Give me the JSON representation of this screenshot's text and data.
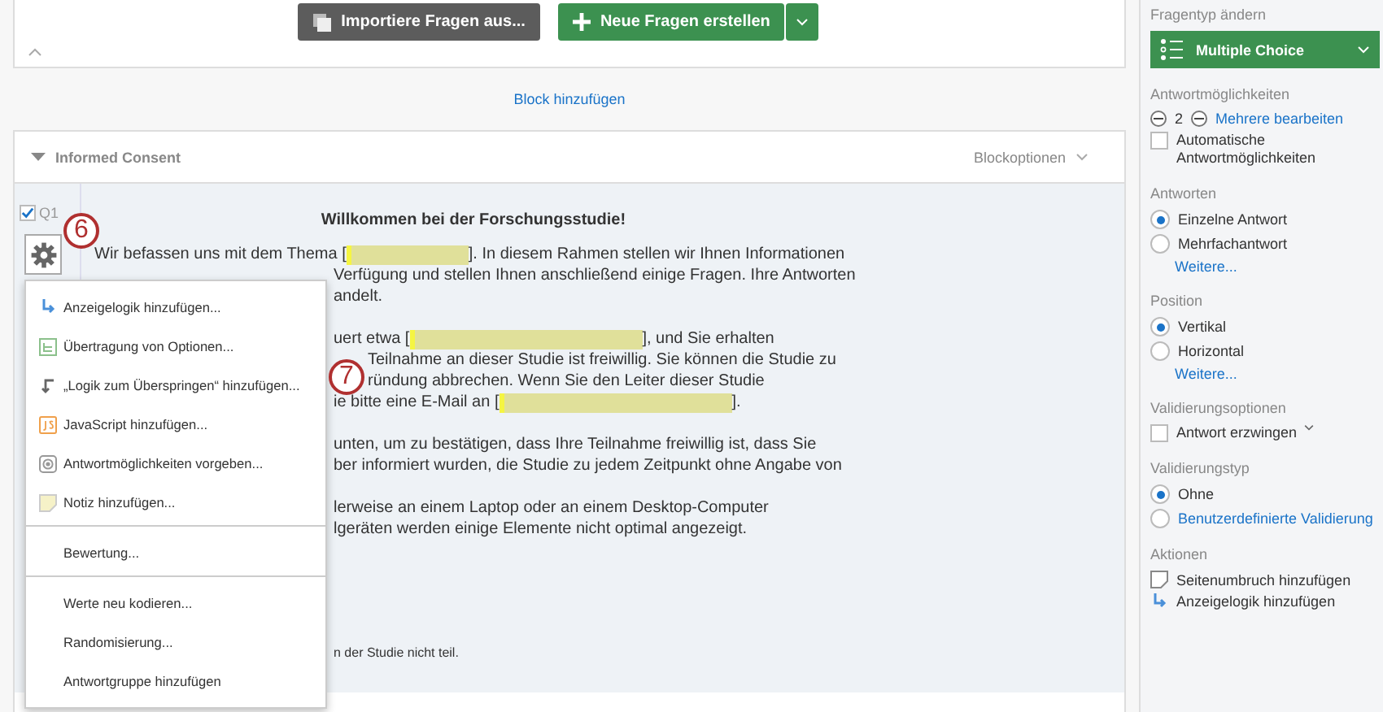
{
  "toolbar": {
    "buttons": [
      {
        "kind": "import",
        "label": "Importiere Fragen aus..."
      },
      {
        "kind": "create",
        "label": "Neue Fragen erstellen"
      }
    ]
  },
  "add_block_link": "Block hinzufügen",
  "block": {
    "title": "Informed Consent",
    "expanded": true,
    "options_label": "Blockoptionen"
  },
  "question": {
    "number": "Q1",
    "checked": true,
    "title": "Willkommen bei der Forschungsstudie!",
    "paragraphs": [
      [
        {
          "kind": "full",
          "parts": [
            {
              "text": "Wir befassen uns mit dem Thema ["
            },
            {
              "kind": "redacted"
            },
            {
              "text": "].  In diesem Rahmen stellen wir Ihnen Informationen"
            }
          ]
        },
        {
          "kind": "behind-menu",
          "parts": [
            {
              "text": "Verfügung und stellen Ihnen anschließend einige Fragen. Ihre Antworten"
            }
          ]
        },
        {
          "kind": "behind-menu",
          "parts": [
            {
              "text": "andelt."
            }
          ]
        }
      ],
      [
        {
          "kind": "behind-menu",
          "parts": [
            {
              "text": "uert etwa ["
            },
            {
              "kind": "redacted",
              "wide": true
            },
            {
              "text": "], und Sie erhalten"
            }
          ]
        },
        {
          "kind": "behind-marker",
          "parts": [
            {
              "text": "Teilnahme an dieser Studie ist freiwillig. Sie können die Studie zu"
            }
          ]
        },
        {
          "kind": "behind-marker",
          "parts": [
            {
              "text": "ründung abbrechen. Wenn Sie den Leiter dieser Studie"
            }
          ]
        },
        {
          "kind": "behind-menu",
          "parts": [
            {
              "text": "ie bitte eine E-Mail an ["
            },
            {
              "kind": "redacted",
              "wide": true
            },
            {
              "text": "]."
            }
          ]
        }
      ],
      [
        {
          "kind": "behind-menu",
          "parts": [
            {
              "text": "unten, um zu bestätigen, dass Ihre Teilnahme freiwillig ist, dass Sie"
            }
          ]
        },
        {
          "kind": "behind-menu",
          "parts": [
            {
              "text": "ber informiert wurden, die Studie zu jedem Zeitpunkt ohne Angabe von"
            }
          ]
        }
      ],
      [
        {
          "kind": "behind-menu",
          "parts": [
            {
              "text": "lerweise an einem Laptop oder an einem Desktop-Computer"
            }
          ]
        },
        {
          "kind": "behind-menu",
          "parts": [
            {
              "text": "lgeräten werden einige Elemente nicht optimal angezeigt."
            }
          ]
        }
      ]
    ],
    "footnote": "n der Studie nicht teil."
  },
  "context_menu": {
    "groups": [
      [
        {
          "kind": "display-logic",
          "label": "Anzeigelogik hinzufügen..."
        },
        {
          "kind": "carry-forward",
          "label": "Übertragung von Optionen..."
        },
        {
          "kind": "skip-logic",
          "label": "„Logik zum Überspringen“ hinzufügen..."
        },
        {
          "kind": "javascript",
          "label": "JavaScript hinzufügen..."
        },
        {
          "kind": "default-choices",
          "label": "Antwortmöglichkeiten vorgeben..."
        },
        {
          "kind": "note",
          "label": "Notiz hinzufügen..."
        }
      ],
      [
        {
          "kind": "plain",
          "label": "Bewertung..."
        }
      ],
      [
        {
          "kind": "plain",
          "label": "Werte neu kodieren..."
        },
        {
          "kind": "plain",
          "label": "Randomisierung..."
        },
        {
          "kind": "plain",
          "label": "Antwortgruppe hinzufügen"
        }
      ]
    ]
  },
  "markers": [
    "6",
    "7"
  ],
  "sidebar": {
    "sections": [
      {
        "heading": "Fragentyp ändern",
        "controls": [
          {
            "kind": "dropdown",
            "label": "Multiple Choice"
          }
        ]
      },
      {
        "heading": "Antwortmöglichkeiten",
        "controls": [
          {
            "kind": "stepper",
            "value": "2",
            "link": "Mehrere bearbeiten"
          },
          {
            "kind": "checkbox",
            "label": "Automatische Antwortmöglichkeiten",
            "checked": false,
            "has_menu": false
          }
        ]
      },
      {
        "heading": "Antworten",
        "controls": [
          {
            "kind": "radio",
            "label": "Einzelne Antwort",
            "selected": true,
            "accent": false
          },
          {
            "kind": "radio",
            "label": "Mehrfachantwort",
            "selected": false,
            "accent": false
          },
          {
            "kind": "link",
            "label": "Weitere..."
          }
        ]
      },
      {
        "heading": "Position",
        "controls": [
          {
            "kind": "radio",
            "label": "Vertikal",
            "selected": true,
            "accent": false
          },
          {
            "kind": "radio",
            "label": "Horizontal",
            "selected": false,
            "accent": false
          },
          {
            "kind": "link",
            "label": "Weitere..."
          }
        ]
      },
      {
        "heading": "Validierungsoptionen",
        "controls": [
          {
            "kind": "checkbox",
            "label": "Antwort erzwingen",
            "checked": false,
            "has_menu": true
          }
        ]
      },
      {
        "heading": "Validierungstyp",
        "controls": [
          {
            "kind": "radio",
            "label": "Ohne",
            "selected": true,
            "accent": false
          },
          {
            "kind": "radio",
            "label": "Benutzerdefinierte Validierung",
            "selected": false,
            "accent": true
          }
        ]
      },
      {
        "heading": "Aktionen",
        "controls": [
          {
            "kind": "page-break-action",
            "label": "Seitenumbruch hinzufügen"
          },
          {
            "kind": "logic-action",
            "label": "Anzeigelogik hinzufügen"
          }
        ]
      }
    ]
  }
}
